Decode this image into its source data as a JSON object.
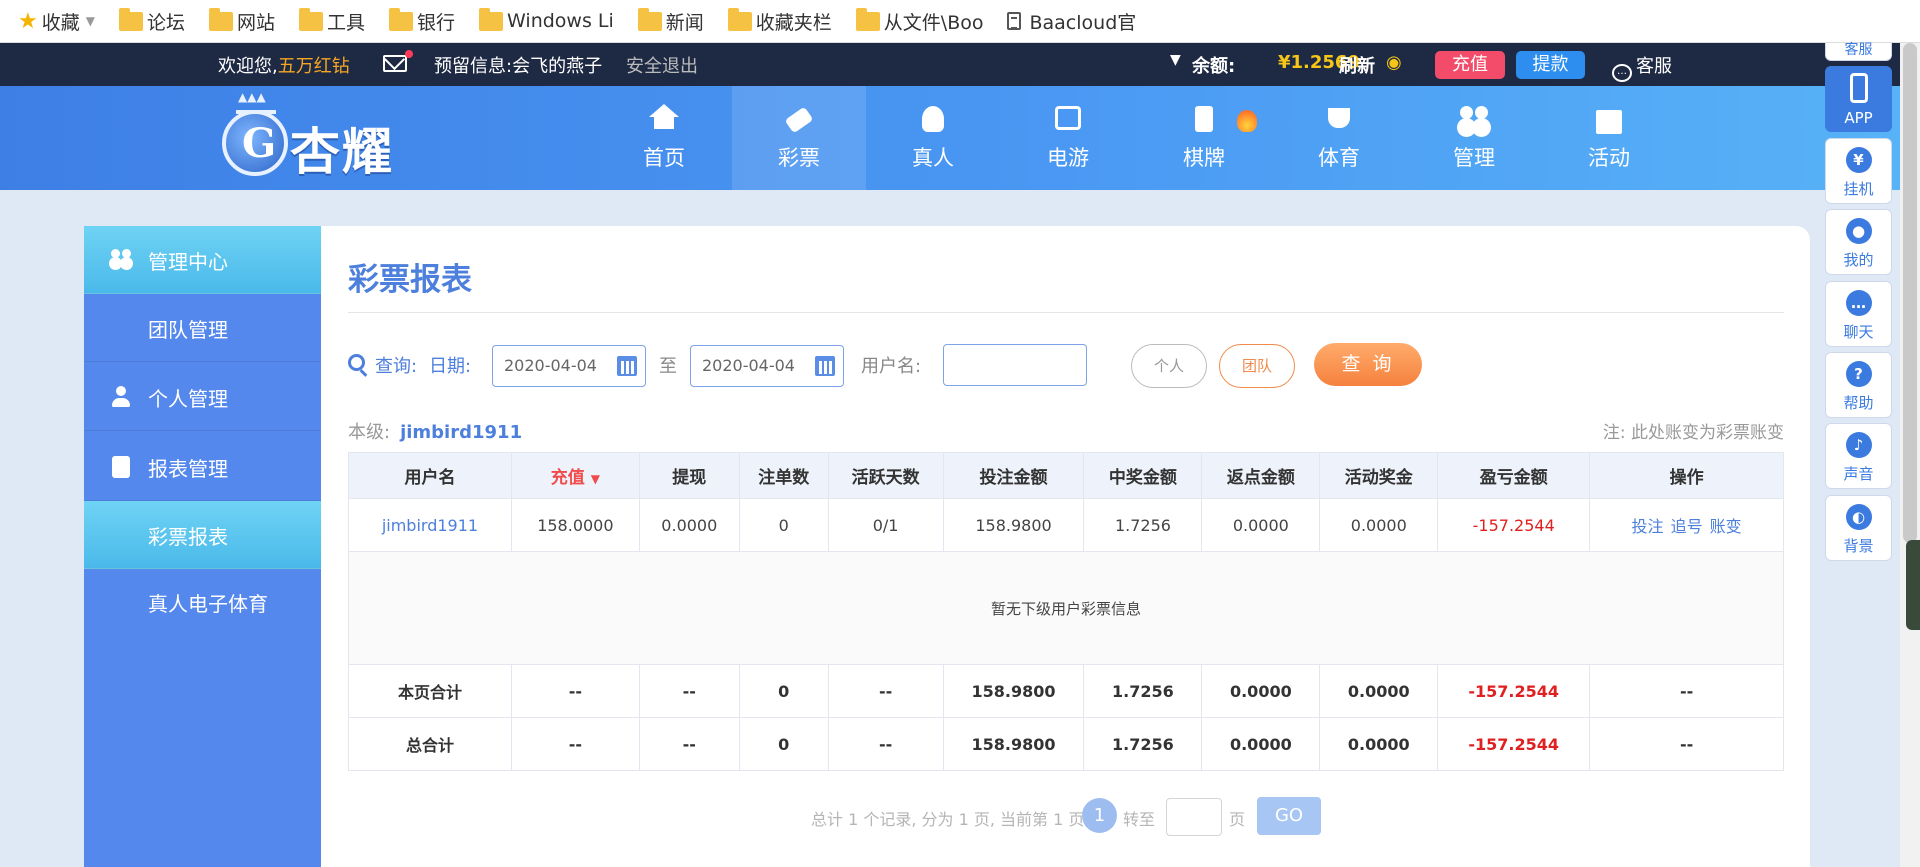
{
  "bookmarks": [
    {
      "label": "收藏",
      "icon": "star-icon"
    },
    {
      "label": "论坛",
      "icon": "folder-icon"
    },
    {
      "label": "网站",
      "icon": "folder-icon"
    },
    {
      "label": "工具",
      "icon": "folder-icon"
    },
    {
      "label": "银行",
      "icon": "folder-icon"
    },
    {
      "label": "Windows Li",
      "icon": "folder-icon"
    },
    {
      "label": "新闻",
      "icon": "folder-icon"
    },
    {
      "label": "收藏夹栏",
      "icon": "folder-icon"
    },
    {
      "label": "从文件\\Boo",
      "icon": "folder-icon"
    },
    {
      "label": "Baacloud官",
      "icon": "document-icon"
    }
  ],
  "topbar": {
    "welcome_prefix": "欢迎您,",
    "username": "五万红钻",
    "reserved_info": "预留信息:会飞的燕子",
    "logout": "安全退出",
    "balance_label": "余额:",
    "balance_value": "¥1.2569",
    "refresh": "刷新",
    "recharge": "充值",
    "withdraw": "提款",
    "customer_service": "客服"
  },
  "logo": {
    "text": "杏耀"
  },
  "nav": [
    {
      "label": "首页",
      "icon": "home-icon"
    },
    {
      "label": "彩票",
      "icon": "ticket-icon",
      "active": true
    },
    {
      "label": "真人",
      "icon": "dealer-icon"
    },
    {
      "label": "电游",
      "icon": "slot-machine-icon"
    },
    {
      "label": "棋牌",
      "icon": "cards-icon"
    },
    {
      "label": "体育",
      "icon": "trophy-icon"
    },
    {
      "label": "管理",
      "icon": "users-icon"
    },
    {
      "label": "活动",
      "icon": "gift-icon"
    }
  ],
  "sidebar": {
    "items": [
      {
        "label": "管理中心",
        "icon": "users-icon",
        "active": true
      },
      {
        "label": "团队管理"
      },
      {
        "label": "个人管理",
        "icon": "user-icon"
      },
      {
        "label": "报表管理",
        "icon": "report-icon"
      },
      {
        "label": "彩票报表",
        "active": true
      },
      {
        "label": "真人电子体育"
      }
    ]
  },
  "main": {
    "title": "彩票报表",
    "query_label": "查询:",
    "date_label": "日期:",
    "date_from": "2020-04-04",
    "to_label": "至",
    "date_to": "2020-04-04",
    "username_label": "用户名:",
    "username_value": "",
    "personal_btn": "个人",
    "team_btn": "团队",
    "query_btn": "查 询",
    "level_label": "本级:",
    "level_account": "jimbird1911",
    "note": "注: 此处账变为彩票账变"
  },
  "table": {
    "headers": [
      "用户名",
      "充值",
      "提现",
      "注单数",
      "活跃天数",
      "投注金额",
      "中奖金额",
      "返点金额",
      "活动奖金",
      "盈亏金额",
      "操作"
    ],
    "row": [
      "jimbird1911",
      "158.0000",
      "0.0000",
      "0",
      "0/1",
      "158.9800",
      "1.7256",
      "0.0000",
      "0.0000",
      "-157.2544"
    ],
    "ops": [
      "投注",
      "追号",
      "账变"
    ],
    "empty_message": "暂无下级用户彩票信息",
    "page_total": [
      "本页合计",
      "--",
      "--",
      "0",
      "--",
      "158.9800",
      "1.7256",
      "0.0000",
      "0.0000",
      "-157.2544",
      "--"
    ],
    "grand_total": [
      "总合计",
      "--",
      "--",
      "0",
      "--",
      "158.9800",
      "1.7256",
      "0.0000",
      "0.0000",
      "-157.2544",
      "--"
    ]
  },
  "pager": {
    "summary": "总计 1 个记录, 分为 1 页, 当前第 1 页",
    "current_page": "1",
    "goto_label": "转至",
    "page_unit": "页",
    "go_btn": "GO"
  },
  "float_bar": {
    "top_cut": "客服",
    "items": [
      {
        "label": "APP",
        "icon": "phone-icon",
        "active": true
      },
      {
        "label": "挂机",
        "icon": "robot-icon"
      },
      {
        "label": "我的",
        "icon": "profile-icon"
      },
      {
        "label": "聊天",
        "icon": "chat-icon"
      },
      {
        "label": "帮助",
        "icon": "help-icon"
      },
      {
        "label": "声音",
        "icon": "speaker-icon"
      },
      {
        "label": "背景",
        "icon": "palette-icon"
      }
    ]
  },
  "colors": {
    "accent_blue": "#4d7fdc",
    "sidebar_blue": "#5588ec",
    "active_cyan": "#4ab9ea",
    "orange": "#f5813e",
    "negative_red": "#e02020"
  }
}
